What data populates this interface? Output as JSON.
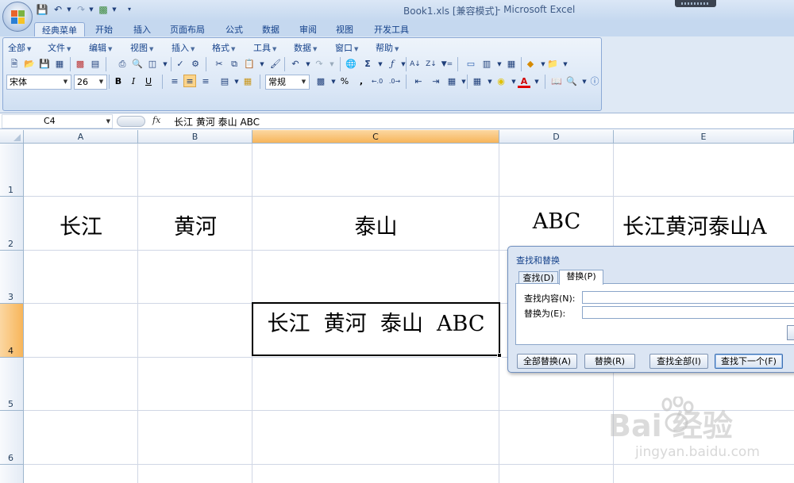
{
  "window": {
    "title": "Book1.xls  [兼容模式]",
    "app": "- Microsoft Excel"
  },
  "quick_access": [
    "save-icon",
    "undo-icon",
    "redo-icon",
    "preview-icon",
    "customize-icon"
  ],
  "tabs": [
    {
      "label": "经典菜单",
      "active": true
    },
    {
      "label": "开始"
    },
    {
      "label": "插入"
    },
    {
      "label": "页面布局"
    },
    {
      "label": "公式"
    },
    {
      "label": "数据"
    },
    {
      "label": "审阅"
    },
    {
      "label": "视图"
    },
    {
      "label": "开发工具"
    }
  ],
  "menus": [
    "全部",
    "文件",
    "编辑",
    "视图",
    "插入",
    "格式",
    "工具",
    "数据",
    "窗口",
    "帮助"
  ],
  "format": {
    "font_name": "宋体",
    "font_size": "26",
    "bold": "B",
    "italic": "I",
    "underline": "U",
    "number_format": "常规",
    "percent": "%",
    "comma": ","
  },
  "formula_bar": {
    "cell_ref": "C4",
    "fx": "fx",
    "value": "长江  黄河  泰山  ABC"
  },
  "columns": [
    "A",
    "B",
    "C",
    "D",
    "E"
  ],
  "selected_column": "C",
  "rows": [
    "1",
    "2",
    "3",
    "4",
    "5",
    "6"
  ],
  "selected_row": "4",
  "cells": {
    "A2": "长江",
    "B2": "黄河",
    "C2": "泰山",
    "D2": "ABC",
    "E2": "长江黄河泰山A",
    "C4": "长江  黄河  泰山  ABC"
  },
  "dialog": {
    "title": "查找和替换",
    "tabs": [
      "查找(D)",
      "替换(P)"
    ],
    "active_tab": "替换(P)",
    "find_label": "查找内容(N):",
    "find_value": "",
    "replace_label": "替换为(E):",
    "replace_value": "",
    "buttons": [
      "全部替换(A)",
      "替换(R)",
      "查找全部(I)",
      "查找下一个(F)"
    ]
  },
  "watermark": {
    "logo": "Bai 经验",
    "url": "jingyan.baidu.com"
  },
  "colors": {
    "accent": "#15428b",
    "selected_header": "#f7b55a",
    "ribbon_bg": "#dfe9f5"
  }
}
